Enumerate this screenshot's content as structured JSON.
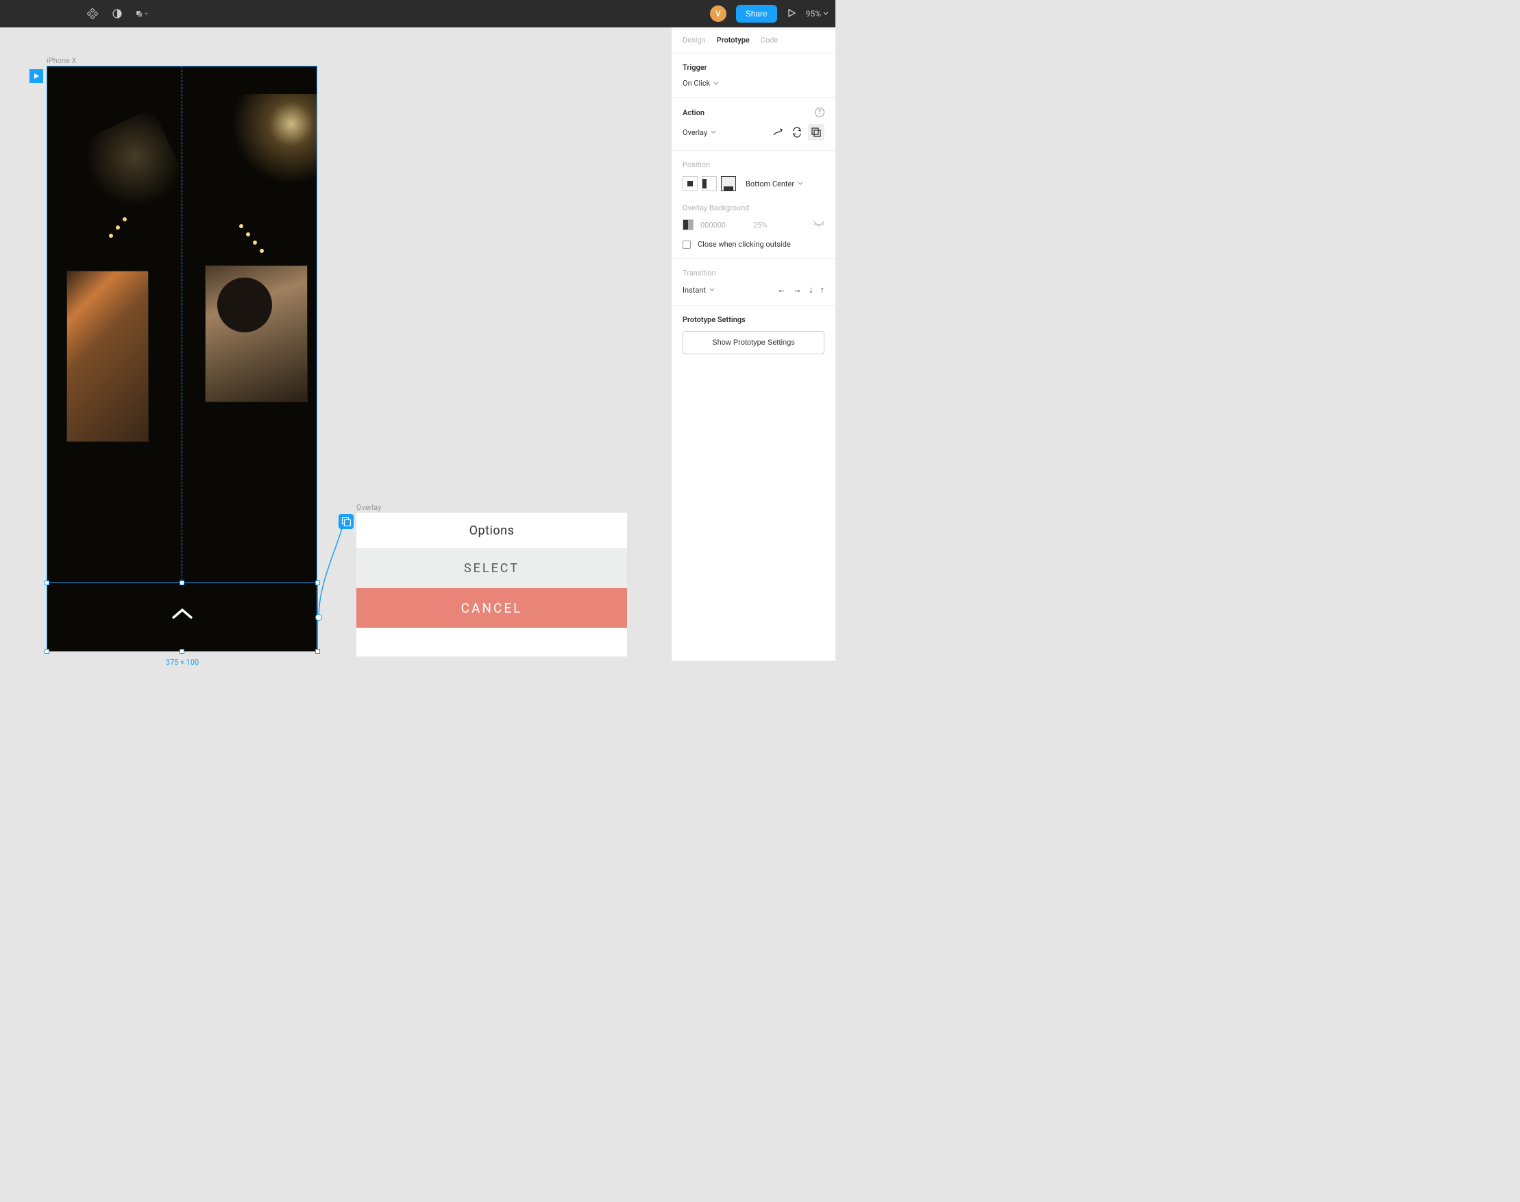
{
  "topbar": {
    "avatar_initial": "V",
    "share_label": "Share",
    "zoom_label": "95%"
  },
  "canvas": {
    "frame_label": "iPhone X",
    "selection_dims": "375 × 100",
    "overlay_label": "Overlay",
    "overlay_rows": {
      "title": "Options",
      "select": "SELECT",
      "cancel": "CANCEL"
    }
  },
  "panel": {
    "tabs": {
      "design": "Design",
      "prototype": "Prototype",
      "code": "Code"
    },
    "active_tab": "prototype",
    "trigger": {
      "heading": "Trigger",
      "value": "On Click"
    },
    "action": {
      "heading": "Action",
      "value": "Overlay"
    },
    "position": {
      "heading": "Position",
      "value": "Bottom Center"
    },
    "overlay_bg": {
      "heading": "Overlay Background",
      "hex": "000000",
      "opacity": "25%"
    },
    "close_outside_label": "Close when clicking outside",
    "transition": {
      "heading": "Transition",
      "value": "Instant"
    },
    "proto_settings_heading": "Prototype Settings",
    "proto_settings_button": "Show Prototype Settings"
  }
}
